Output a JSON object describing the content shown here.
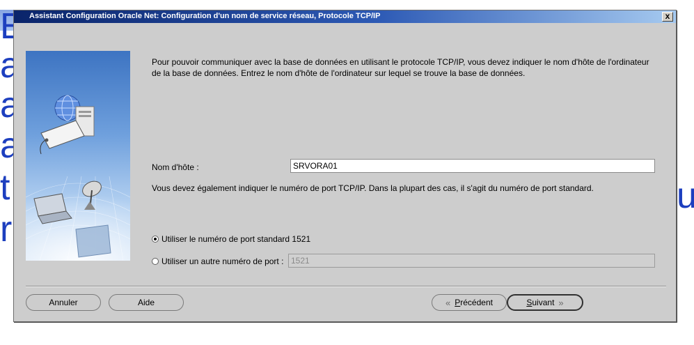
{
  "background": {
    "glyphs": [
      "E",
      "a",
      "a",
      "a",
      "t",
      "r"
    ],
    "right_glyph": "u"
  },
  "window": {
    "title": "Assistant Configuration Oracle Net: Configuration d'un nom de service réseau, Protocole TCP/IP",
    "close_label": "x"
  },
  "content": {
    "intro": "Pour pouvoir communiquer avec la base de données en utilisant le protocole TCP/IP, vous devez indiquer le nom d'hôte de l'ordinateur de la base de données. Entrez le nom d'hôte de l'ordinateur sur lequel se trouve la base de données.",
    "host_label": "Nom d'hôte :",
    "host_value": "SRVORA01",
    "port_intro": "Vous devez également indiquer le numéro de port TCP/IP. Dans la plupart des cas, il s'agit du numéro de port standard.",
    "radio_standard": "Utiliser le numéro de port standard 1521",
    "radio_standard_checked": true,
    "radio_other": "Utiliser un autre numéro de port :",
    "port_value": "1521"
  },
  "buttons": {
    "cancel": "Annuler",
    "help": "Aide",
    "prev_first": "P",
    "prev_rest": "récédent",
    "next_first": "S",
    "next_rest": "uivant",
    "prev_icon": "chevron-left-double-icon",
    "next_icon": "chevron-right-double-icon"
  },
  "colors": {
    "titlebar": "#0a246a",
    "dialog_bg": "#cdcdcd",
    "background_text": "#1d3fbf"
  }
}
